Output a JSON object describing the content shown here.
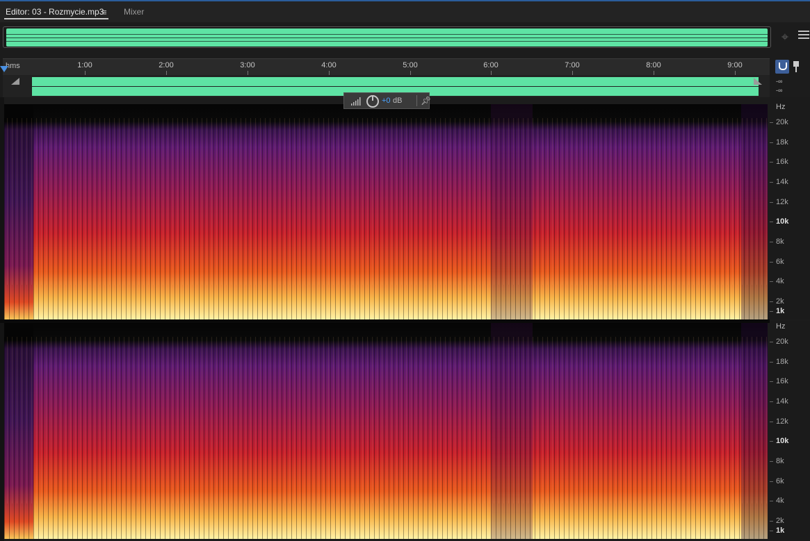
{
  "tabs": {
    "editor_label": "Editor: 03 - Rozmycie.mp3",
    "menu_icon": "hamburger-menu-icon",
    "mixer_label": "Mixer"
  },
  "ruler": {
    "units": "hms",
    "ticks": [
      "1:00",
      "2:00",
      "3:00",
      "4:00",
      "5:00",
      "6:00",
      "7:00",
      "8:00",
      "9:00"
    ]
  },
  "channels": {
    "ch1_db": "-∞",
    "ch2_db": "-∞"
  },
  "hud": {
    "value": "+0",
    "unit": "dB"
  },
  "frequency_axis": {
    "unit": "Hz",
    "labels": [
      "20k",
      "18k",
      "16k",
      "14k",
      "12k",
      "10k",
      "8k",
      "6k",
      "4k",
      "2k",
      "1k"
    ]
  },
  "colors": {
    "waveform": "#5ee3a4",
    "accent": "#4a90e2",
    "spectrogram_low": "#fdf5a0",
    "spectrogram_mid": "#e8401c",
    "spectrogram_high": "#5a1a7a"
  }
}
